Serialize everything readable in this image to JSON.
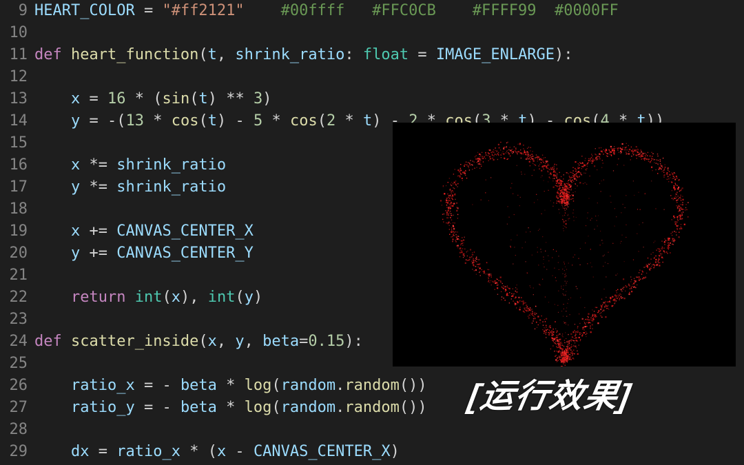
{
  "editor": {
    "startLine": 9,
    "lines": [
      {
        "n": 9,
        "tokens": [
          [
            "var",
            "HEART_COLOR"
          ],
          [
            "op",
            " = "
          ],
          [
            "str",
            "\"#ff2121\""
          ],
          [
            "op",
            "    "
          ],
          [
            "cmt",
            "#00ffff   #FFC0CB    #FFFF99  #0000FF"
          ]
        ]
      },
      {
        "n": 10,
        "tokens": []
      },
      {
        "n": 11,
        "tokens": [
          [
            "kw",
            "def "
          ],
          [
            "fn",
            "heart_function"
          ],
          [
            "pun",
            "("
          ],
          [
            "var",
            "t"
          ],
          [
            "pun",
            ", "
          ],
          [
            "var",
            "shrink_ratio"
          ],
          [
            "pun",
            ": "
          ],
          [
            "typ",
            "float"
          ],
          [
            "op",
            " = "
          ],
          [
            "var",
            "IMAGE_ENLARGE"
          ],
          [
            "pun",
            "):"
          ]
        ]
      },
      {
        "n": 12,
        "tokens": []
      },
      {
        "n": 13,
        "tokens": [
          [
            "op",
            "    "
          ],
          [
            "var",
            "x"
          ],
          [
            "op",
            " = "
          ],
          [
            "num",
            "16"
          ],
          [
            "op",
            " * ("
          ],
          [
            "fn",
            "sin"
          ],
          [
            "pun",
            "("
          ],
          [
            "var",
            "t"
          ],
          [
            "pun",
            ")"
          ],
          [
            "op",
            " ** "
          ],
          [
            "num",
            "3"
          ],
          [
            "pun",
            ")"
          ]
        ]
      },
      {
        "n": 14,
        "tokens": [
          [
            "op",
            "    "
          ],
          [
            "var",
            "y"
          ],
          [
            "op",
            " = -("
          ],
          [
            "num",
            "13"
          ],
          [
            "op",
            " * "
          ],
          [
            "fn",
            "cos"
          ],
          [
            "pun",
            "("
          ],
          [
            "var",
            "t"
          ],
          [
            "pun",
            ")"
          ],
          [
            "op",
            " - "
          ],
          [
            "num",
            "5"
          ],
          [
            "op",
            " * "
          ],
          [
            "fn",
            "cos"
          ],
          [
            "pun",
            "("
          ],
          [
            "num",
            "2"
          ],
          [
            "op",
            " * "
          ],
          [
            "var",
            "t"
          ],
          [
            "pun",
            ")"
          ],
          [
            "op",
            " - "
          ],
          [
            "num",
            "2"
          ],
          [
            "op",
            " * "
          ],
          [
            "fn",
            "cos"
          ],
          [
            "pun",
            "("
          ],
          [
            "num",
            "3"
          ],
          [
            "op",
            " * "
          ],
          [
            "var",
            "t"
          ],
          [
            "pun",
            ")"
          ],
          [
            "op",
            " - "
          ],
          [
            "fn",
            "cos"
          ],
          [
            "pun",
            "("
          ],
          [
            "num",
            "4"
          ],
          [
            "op",
            " * "
          ],
          [
            "var",
            "t"
          ],
          [
            "pun",
            "))"
          ]
        ]
      },
      {
        "n": 15,
        "tokens": []
      },
      {
        "n": 16,
        "tokens": [
          [
            "op",
            "    "
          ],
          [
            "var",
            "x"
          ],
          [
            "op",
            " *= "
          ],
          [
            "var",
            "shrink_ratio"
          ]
        ]
      },
      {
        "n": 17,
        "tokens": [
          [
            "op",
            "    "
          ],
          [
            "var",
            "y"
          ],
          [
            "op",
            " *= "
          ],
          [
            "var",
            "shrink_ratio"
          ]
        ]
      },
      {
        "n": 18,
        "tokens": []
      },
      {
        "n": 19,
        "tokens": [
          [
            "op",
            "    "
          ],
          [
            "var",
            "x"
          ],
          [
            "op",
            " += "
          ],
          [
            "var",
            "CANVAS_CENTER_X"
          ]
        ]
      },
      {
        "n": 20,
        "tokens": [
          [
            "op",
            "    "
          ],
          [
            "var",
            "y"
          ],
          [
            "op",
            " += "
          ],
          [
            "var",
            "CANVAS_CENTER_Y"
          ]
        ]
      },
      {
        "n": 21,
        "tokens": []
      },
      {
        "n": 22,
        "tokens": [
          [
            "op",
            "    "
          ],
          [
            "kw",
            "return "
          ],
          [
            "typ",
            "int"
          ],
          [
            "pun",
            "("
          ],
          [
            "var",
            "x"
          ],
          [
            "pun",
            "), "
          ],
          [
            "typ",
            "int"
          ],
          [
            "pun",
            "("
          ],
          [
            "var",
            "y"
          ],
          [
            "pun",
            ")"
          ]
        ]
      },
      {
        "n": 23,
        "tokens": []
      },
      {
        "n": 24,
        "tokens": [
          [
            "kw",
            "def "
          ],
          [
            "fn",
            "scatter_inside"
          ],
          [
            "pun",
            "("
          ],
          [
            "var",
            "x"
          ],
          [
            "pun",
            ", "
          ],
          [
            "var",
            "y"
          ],
          [
            "pun",
            ", "
          ],
          [
            "var",
            "beta"
          ],
          [
            "op",
            "="
          ],
          [
            "num",
            "0.15"
          ],
          [
            "pun",
            "):"
          ]
        ]
      },
      {
        "n": 25,
        "tokens": []
      },
      {
        "n": 26,
        "tokens": [
          [
            "op",
            "    "
          ],
          [
            "var",
            "ratio_x"
          ],
          [
            "op",
            " = - "
          ],
          [
            "var",
            "beta"
          ],
          [
            "op",
            " * "
          ],
          [
            "fn",
            "log"
          ],
          [
            "pun",
            "("
          ],
          [
            "var",
            "random"
          ],
          [
            "pun",
            "."
          ],
          [
            "fn",
            "random"
          ],
          [
            "pun",
            "())"
          ]
        ]
      },
      {
        "n": 27,
        "tokens": [
          [
            "op",
            "    "
          ],
          [
            "var",
            "ratio_y"
          ],
          [
            "op",
            " = - "
          ],
          [
            "var",
            "beta"
          ],
          [
            "op",
            " * "
          ],
          [
            "fn",
            "log"
          ],
          [
            "pun",
            "("
          ],
          [
            "var",
            "random"
          ],
          [
            "pun",
            "."
          ],
          [
            "fn",
            "random"
          ],
          [
            "pun",
            "())"
          ]
        ]
      },
      {
        "n": 28,
        "tokens": []
      },
      {
        "n": 29,
        "tokens": [
          [
            "op",
            "    "
          ],
          [
            "var",
            "dx"
          ],
          [
            "op",
            " = "
          ],
          [
            "var",
            "ratio_x"
          ],
          [
            "op",
            " * ("
          ],
          [
            "var",
            "x"
          ],
          [
            "op",
            " - "
          ],
          [
            "var",
            "CANVAS_CENTER_X"
          ],
          [
            "pun",
            ")"
          ]
        ]
      }
    ]
  },
  "overlay": {
    "caption": "[运行效果]",
    "heart_color": "#ff2121"
  }
}
